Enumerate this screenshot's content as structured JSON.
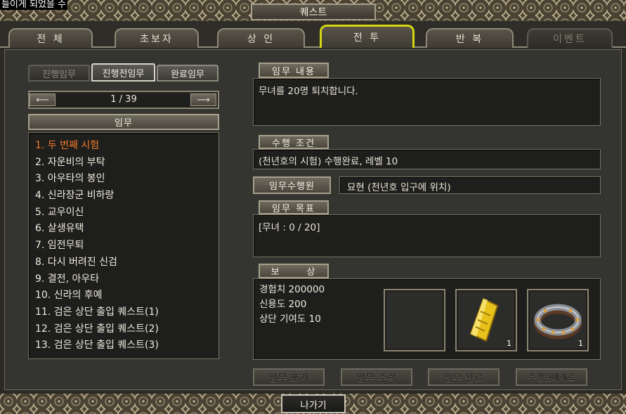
{
  "top_left_text": "들이게 되었을 수",
  "window_title": "퀘스트",
  "main_tabs": [
    {
      "label": "전   체",
      "state": "normal"
    },
    {
      "label": "초보자",
      "state": "normal"
    },
    {
      "label": "상   인",
      "state": "normal"
    },
    {
      "label": "전   투",
      "state": "active"
    },
    {
      "label": "반   복",
      "state": "normal"
    },
    {
      "label": "이벤트",
      "state": "disabled"
    }
  ],
  "sub_tabs": [
    {
      "label": "진행임무",
      "state": "disabled"
    },
    {
      "label": "진행전임무",
      "state": "active"
    },
    {
      "label": "완료임무",
      "state": "normal"
    }
  ],
  "pager": {
    "text": "1 / 39"
  },
  "list_header": "임무",
  "quests": [
    "1. 두 번째 시험",
    "2. 자운비의 부탁",
    "3. 아우타의 봉인",
    "4. 신라장군 비하랑",
    "5. 교우이신",
    "6. 살생유택",
    "7. 임전무퇴",
    "8. 다시 버려진 신검",
    "9. 결전, 아우타",
    "10. 신라의 후예",
    "11. 검은 상단 출입 퀘스트(1)",
    "12. 검은 상단 출입 퀘스트(2)",
    "13. 검은 상단 출입 퀘스트(3)"
  ],
  "selected_quest_index": 0,
  "detail": {
    "content_label": "임무 내용",
    "content_text": "무녀를 20명 퇴치합니다.",
    "condition_label": "수행 조건",
    "condition_text": "(천년호의 시험) 수행완료, 레벨 10",
    "giver_label": "임무수행원",
    "giver_text": "묘현 (천년호 입구에 위치)",
    "goal_label": "임무 목표",
    "goal_text": "[무녀 : 0 / 20]",
    "reward_label": "보      상",
    "rewards": [
      "경험치 200000",
      "신용도 200",
      "상단 기여도 10"
    ],
    "reward_items": [
      {
        "icon": "empty-slot",
        "count": ""
      },
      {
        "icon": "yellow-scroll-icon",
        "count": "1"
      },
      {
        "icon": "studded-ring-icon",
        "count": "1"
      }
    ]
  },
  "action_buttons": [
    "임무 포기",
    "임무 수락",
    "임무 완료",
    "수행원에게로"
  ],
  "exit_button": "나가기",
  "colors": {
    "active_tab_border": "#d6d613",
    "selected_quest": "#f07a2a"
  }
}
